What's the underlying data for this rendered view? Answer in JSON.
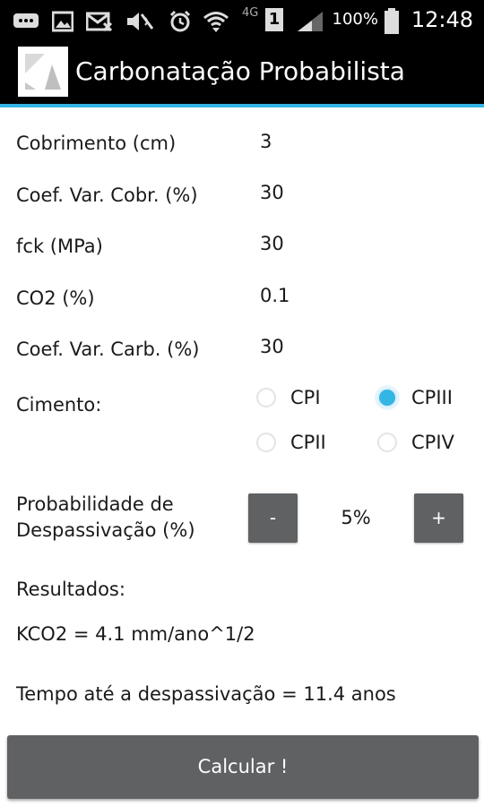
{
  "status_bar": {
    "battery": "100%",
    "time": "12:48",
    "network": "4G",
    "sim": "1",
    "icons": [
      "message-icon",
      "image-icon",
      "mail-icon",
      "mute-icon",
      "alarm-icon",
      "wifi-icon",
      "signal-icon",
      "battery-icon"
    ]
  },
  "app_bar": {
    "title": "Carbonatação Probabilista"
  },
  "form": {
    "fields": [
      {
        "label": "Cobrimento (cm)",
        "value": "3"
      },
      {
        "label": "Coef. Var. Cobr. (%)",
        "value": "30"
      },
      {
        "label": "fck (MPa)",
        "value": "30"
      },
      {
        "label": "CO2 (%)",
        "value": "0.1"
      },
      {
        "label": "Coef. Var. Carb. (%)",
        "value": "30"
      }
    ],
    "cimento": {
      "label": "Cimento:",
      "options": [
        "CPI",
        "CPIII",
        "CPII",
        "CPIV"
      ],
      "selected": "CPIII"
    },
    "probabilidade": {
      "label_line1": "Probabilidade  de",
      "label_line2": "Despassivação (%)",
      "minus": "-",
      "value": "5%",
      "plus": "+"
    }
  },
  "results": {
    "header": "Resultados:",
    "kco2": "KCO2  =  4.1 mm/ano^1/2",
    "tempo": "Tempo até a despassivação =  11.4 anos"
  },
  "calcular_label": "Calcular !",
  "colors": {
    "accent": "#33b5e5",
    "button": "#5f6163",
    "bar": "#000000"
  }
}
